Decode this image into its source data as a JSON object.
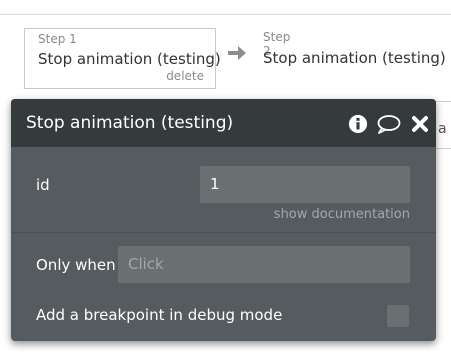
{
  "workflow": {
    "steps": [
      {
        "label": "Step 1",
        "title": "Stop animation (testing)",
        "delete_label": "delete"
      },
      {
        "label": "Step 2",
        "title": "Stop animation (testing)"
      }
    ],
    "offscreen_text": "a"
  },
  "panel": {
    "title": "Stop animation (testing)",
    "icons": [
      "info-icon",
      "comment-icon",
      "close-icon"
    ],
    "fields": {
      "id": {
        "label": "id",
        "value": "1"
      },
      "show_documentation": "show documentation",
      "only_when": {
        "label": "Only when",
        "placeholder": "Click"
      },
      "breakpoint": {
        "label": "Add a breakpoint in debug mode",
        "checked": false
      }
    }
  },
  "colors": {
    "panel_header_bg": "#353b3d",
    "panel_body_bg": "#555b5e",
    "input_bg": "#6a6f72",
    "step_border": "#c9c9c9"
  }
}
